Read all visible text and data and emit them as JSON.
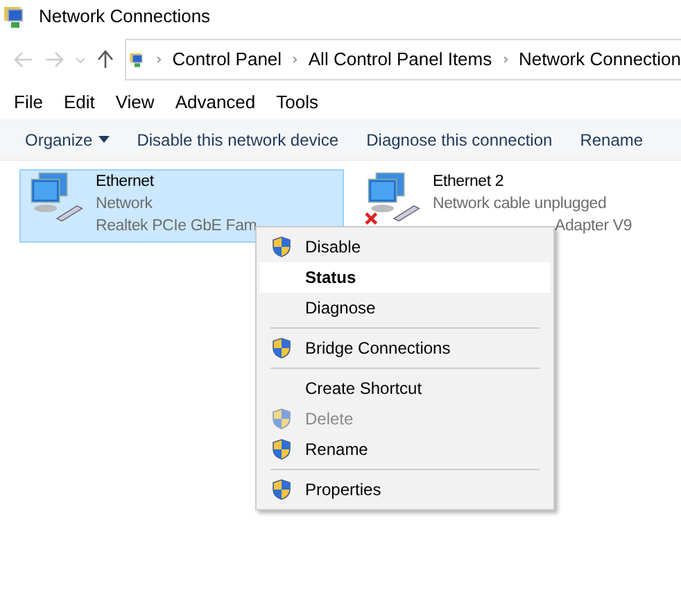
{
  "window": {
    "title": "Network Connections"
  },
  "address_bar": {
    "breadcrumbs": [
      "Control Panel",
      "All Control Panel Items",
      "Network Connection"
    ]
  },
  "menu_bar": [
    "File",
    "Edit",
    "View",
    "Advanced",
    "Tools"
  ],
  "command_bar": [
    {
      "label": "Organize",
      "dropdown": true
    },
    {
      "label": "Disable this network device",
      "dropdown": false
    },
    {
      "label": "Diagnose this connection",
      "dropdown": false
    },
    {
      "label": "Rename",
      "dropdown": false
    }
  ],
  "connections": [
    {
      "name": "Ethernet",
      "status": "Network",
      "adapter": "Realtek PCIe GbE Fam",
      "selected": true,
      "unplugged": false
    },
    {
      "name": "Ethernet 2",
      "status": "Network cable unplugged",
      "adapter": "Adapter V9",
      "selected": false,
      "unplugged": true
    }
  ],
  "context_menu": [
    {
      "kind": "item",
      "label": "Disable",
      "shield": true,
      "default": false,
      "disabled": false,
      "selected": false
    },
    {
      "kind": "item",
      "label": "Status",
      "shield": false,
      "default": true,
      "disabled": false,
      "selected": true
    },
    {
      "kind": "item",
      "label": "Diagnose",
      "shield": false,
      "default": false,
      "disabled": false,
      "selected": false
    },
    {
      "kind": "separator"
    },
    {
      "kind": "item",
      "label": "Bridge Connections",
      "shield": true,
      "default": false,
      "disabled": false,
      "selected": false
    },
    {
      "kind": "separator"
    },
    {
      "kind": "item",
      "label": "Create Shortcut",
      "shield": false,
      "default": false,
      "disabled": false,
      "selected": false
    },
    {
      "kind": "item",
      "label": "Delete",
      "shield": true,
      "default": false,
      "disabled": true,
      "selected": false
    },
    {
      "kind": "item",
      "label": "Rename",
      "shield": true,
      "default": false,
      "disabled": false,
      "selected": false
    },
    {
      "kind": "separator"
    },
    {
      "kind": "item",
      "label": "Properties",
      "shield": true,
      "default": false,
      "disabled": false,
      "selected": false
    }
  ]
}
